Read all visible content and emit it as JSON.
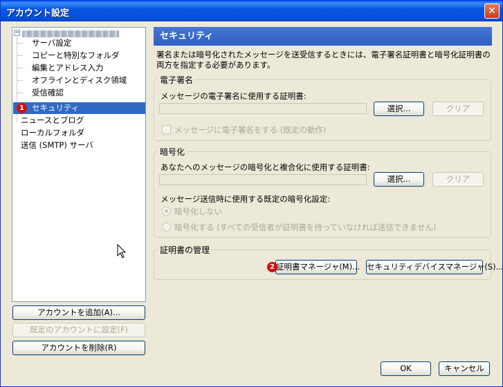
{
  "window": {
    "title": "アカウント設定",
    "close_glyph": "✕"
  },
  "tree": {
    "items": [
      {
        "label": "サーバ設定"
      },
      {
        "label": "コピーと特別なフォルダ"
      },
      {
        "label": "編集とアドレス入力"
      },
      {
        "label": "オフラインとディスク領域"
      },
      {
        "label": "受信確認"
      },
      {
        "label": "セキュリティ"
      },
      {
        "label": "ニュースとブログ"
      },
      {
        "label": "ローカルフォルダ"
      },
      {
        "label": "送信 (SMTP) サーバ"
      }
    ],
    "expander": "−",
    "selected_badge": "1"
  },
  "left_buttons": {
    "add_account": "アカウントを追加(A)...",
    "set_default": "既定のアカウントに設定(F)",
    "delete_account": "アカウントを削除(R)"
  },
  "panel": {
    "title": "セキュリティ",
    "description": "署名または暗号化されたメッセージを送受信するときには、電子署名証明書と暗号化証明書の両方を指定する必要があります。",
    "signing": {
      "group_label": "電子署名",
      "cert_label": "メッセージの電子署名に使用する証明書:",
      "select_button": "選択...",
      "clear_button": "クリア",
      "checkbox_label": "メッセージに電子署名をする (既定の動作)"
    },
    "encryption": {
      "group_label": "暗号化",
      "cert_label": "あなたへのメッセージの暗号化と複合化に使用する証明書:",
      "select_button": "選択...",
      "clear_button": "クリア",
      "default_label": "メッセージ送信時に使用する既定の暗号化設定:",
      "radio_none": "暗号化しない",
      "radio_required": "暗号化する (すべての受信者が証明書を持っていなければ送信できません)"
    },
    "cert_management": {
      "group_label": "証明書の管理",
      "manager_badge": "2",
      "cert_manager_button": "証明書マネージャ(M)...",
      "device_manager_button": "セキュリティデバイスマネージャ(S)..."
    }
  },
  "footer": {
    "ok": "OK",
    "cancel": "キャンセル"
  },
  "colors": {
    "titlebar": "#0556e1",
    "selection": "#316ac5",
    "section_header": "#3a6ccb",
    "badge": "#d01010"
  }
}
